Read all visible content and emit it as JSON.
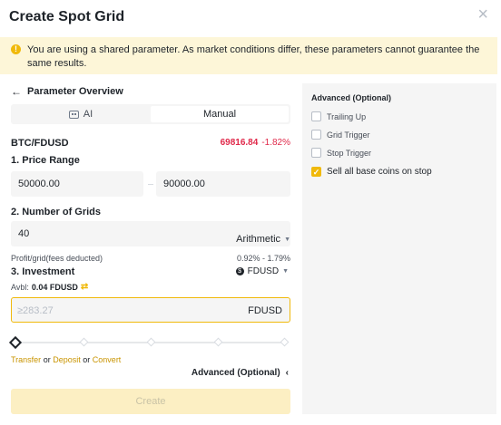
{
  "dialog": {
    "title": "Create Spot Grid",
    "close_symbol": "×"
  },
  "notice": {
    "icon": "!",
    "text": "You are using a shared parameter. As market conditions differ, these parameters cannot guarantee the same results."
  },
  "nav": {
    "back_label": "Parameter Overview"
  },
  "tabs": {
    "ai_label": "AI",
    "manual_label": "Manual",
    "active": "Manual"
  },
  "market": {
    "pair": "BTC/FDUSD",
    "price": "69816.84",
    "change": "-1.82%",
    "change_color": "#e0294a"
  },
  "price_range": {
    "label": "1. Price Range",
    "lower": "50000.00",
    "upper": "90000.00"
  },
  "grids": {
    "label": "2. Number of Grids",
    "count": "40",
    "mode": "Arithmetic"
  },
  "profit": {
    "label": "Profit/grid(fees deducted)",
    "value": "0.92% - 1.79%"
  },
  "investment": {
    "label": "3. Investment",
    "coin": "FDUSD",
    "avbl_label": "Avbl:",
    "avbl_value": "0.04 FDUSD",
    "placeholder": "≥283.27",
    "unit": "FDUSD",
    "slider_percent": 0
  },
  "links": {
    "transfer": "Transfer",
    "or1": "or",
    "deposit": "Deposit",
    "or2": "or",
    "convert": "Convert"
  },
  "advanced_toggle": {
    "label": "Advanced (Optional)"
  },
  "create_button": {
    "label": "Create"
  },
  "advanced_panel": {
    "title": "Advanced (Optional)",
    "options": [
      {
        "label": "Trailing Up",
        "checked": false
      },
      {
        "label": "Grid Trigger",
        "checked": false
      },
      {
        "label": "Stop Trigger",
        "checked": false
      },
      {
        "label": "Sell all base coins on stop",
        "checked": true
      }
    ]
  },
  "colors": {
    "accent": "#f0b90b",
    "negative": "#e0294a",
    "notice_bg": "#fdf6d8"
  }
}
